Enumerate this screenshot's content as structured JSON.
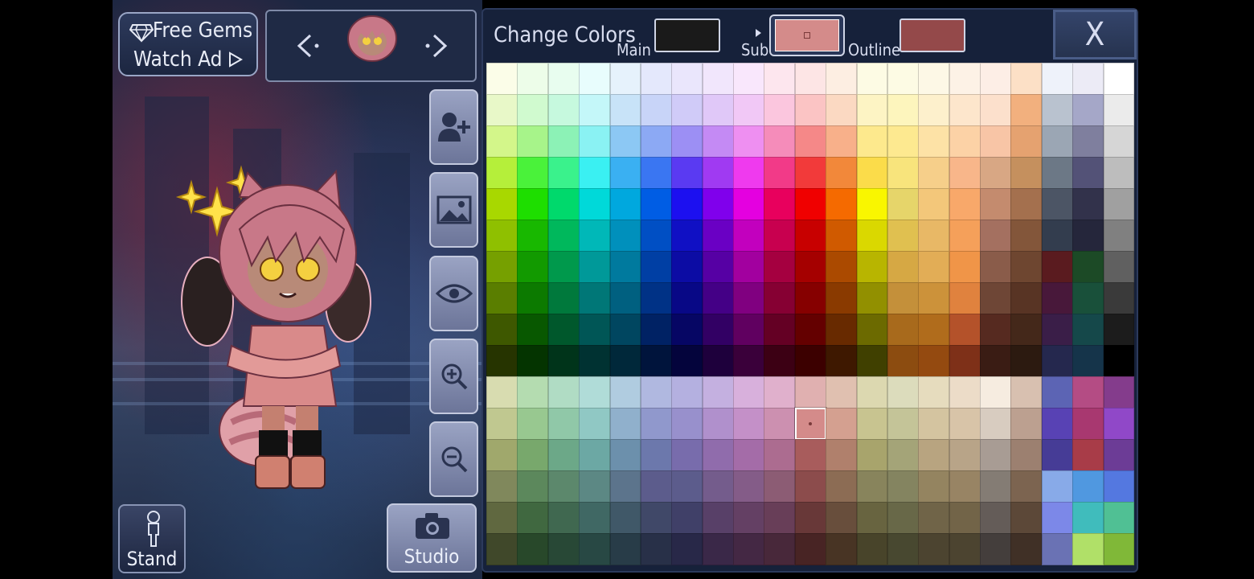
{
  "top": {
    "free_gems": "Free Gems",
    "watch_ad": "Watch Ad"
  },
  "bottom": {
    "stand_label": "Stand",
    "studio_label": "Studio"
  },
  "color_panel": {
    "title": "Change Colors",
    "main_label": "Main",
    "sub_label": "Sub",
    "outline_label": "Outline",
    "close_label": "X",
    "main_color": "#1a1a1a",
    "sub_color": "#d48b8a",
    "outline_color": "#94494a",
    "selected_cell": "#d48b8a"
  },
  "icons": [
    "diamond-icon",
    "play-triangle-icon",
    "arrow-left-icon",
    "arrow-right-icon",
    "add-character-icon",
    "background-image-icon",
    "eye-icon",
    "zoom-in-icon",
    "zoom-out-icon",
    "stand-pose-icon",
    "camera-icon",
    "close-icon"
  ],
  "palette": {
    "upper": [
      [
        "#fbfde8",
        "#edfde9",
        "#e8fdef",
        "#e8fdfd",
        "#e6f2fc",
        "#e4e8fc",
        "#eae6fc",
        "#f1e6fc",
        "#f9e7fc",
        "#fde6ee",
        "#fde5e5",
        "#fdeee2",
        "#fdfbe4",
        "#fdfbe4",
        "#fdf8e6",
        "#fdf2e6",
        "#fdeee6",
        "#fce0c6",
        "#eef2fa",
        "#ecebf6",
        "#ffffff"
      ],
      [
        "#e8f8c8",
        "#d0facf",
        "#c6f9de",
        "#c4f7f9",
        "#c8e3f8",
        "#c8d4f8",
        "#d0cbf8",
        "#e0c8f8",
        "#f1c8f6",
        "#fbc6de",
        "#fbc4c4",
        "#fbd9c2",
        "#fdf4c4",
        "#fdf5bd",
        "#fdf0cc",
        "#fde6cc",
        "#fce0cc",
        "#f2b07e",
        "#b9c2cf",
        "#a5a7c8",
        "#ebebeb"
      ],
      [
        "#d3f68a",
        "#a7f48a",
        "#8cf2b6",
        "#8af2f3",
        "#8cc8f4",
        "#8ca9f4",
        "#9c8ff4",
        "#c48af4",
        "#ee8ff1",
        "#f58cba",
        "#f58888",
        "#f8b08a",
        "#fde98d",
        "#fde990",
        "#fde2a6",
        "#fcd2a6",
        "#f8c5a6",
        "#e5a270",
        "#9ba6b4",
        "#7f7f9e",
        "#d6d6d6"
      ],
      [
        "#b5ef3a",
        "#4af23a",
        "#3af28c",
        "#3af0f2",
        "#3ab0f2",
        "#3a76f2",
        "#5a3af2",
        "#a03af2",
        "#ef3aee",
        "#f23a88",
        "#f23a3a",
        "#f2883a",
        "#fbdc4a",
        "#f8e47c",
        "#f6cf8a",
        "#f8b68a",
        "#d8a784",
        "#c5905e",
        "#6c7886",
        "#535277",
        "#bdbdbd"
      ],
      [
        "#a8d800",
        "#1ede00",
        "#00d96c",
        "#00d9d9",
        "#00a8de",
        "#005de4",
        "#1c10f0",
        "#8000ec",
        "#e400e0",
        "#e8005d",
        "#f00000",
        "#f56a00",
        "#f9f600",
        "#e6d56a",
        "#f3c77a",
        "#f8a86a",
        "#c48b6e",
        "#a4704e",
        "#4c5565",
        "#32324b",
        "#a0a0a0"
      ],
      [
        "#8fc000",
        "#18b800",
        "#00b85c",
        "#00b8b8",
        "#0090bc",
        "#004fc4",
        "#1010c4",
        "#6a00c4",
        "#c200be",
        "#c8004f",
        "#c80000",
        "#d05a00",
        "#dad800",
        "#e0c050",
        "#e8b866",
        "#f5a05a",
        "#a47060",
        "#83563a",
        "#333d4e",
        "#25263b",
        "#808080"
      ],
      [
        "#76a000",
        "#129a00",
        "#00994c",
        "#009999",
        "#007a9e",
        "#003fa4",
        "#0c0ca4",
        "#5600a4",
        "#a2009f",
        "#a50040",
        "#a50000",
        "#ab4a00",
        "#b8b500",
        "#d6a844",
        "#e2ad56",
        "#f09548",
        "#8a5c4a",
        "#6e4630",
        "#5a1b1f",
        "#1c4a26",
        "#606060"
      ],
      [
        "#5a7e00",
        "#0c7a00",
        "#00793c",
        "#007777",
        "#006080",
        "#003286",
        "#080886",
        "#440086",
        "#800080",
        "#860033",
        "#860000",
        "#8a3a00",
        "#929000",
        "#c4903a",
        "#cc923a",
        "#e0823e",
        "#6e4636",
        "#583424",
        "#48183a",
        "#19503a",
        "#3a3a3a"
      ],
      [
        "#3e5800",
        "#085800",
        "#00582c",
        "#005656",
        "#004660",
        "#002264",
        "#060664",
        "#320064",
        "#600060",
        "#640024",
        "#640000",
        "#682a00",
        "#6c6a00",
        "#a86a1c",
        "#b06c1c",
        "#b4522a",
        "#562a20",
        "#44281a",
        "#3a1e48",
        "#15484a",
        "#1c1c1c"
      ],
      [
        "#263400",
        "#043400",
        "#00341a",
        "#003232",
        "#00283a",
        "#00143c",
        "#04043c",
        "#1e003c",
        "#3a003a",
        "#3c0014",
        "#3c0000",
        "#3e1800",
        "#404000",
        "#8c4c10",
        "#944a10",
        "#7e3018",
        "#3a1c14",
        "#2c1a10",
        "#25284e",
        "#15344a",
        "#000000"
      ]
    ],
    "lower": [
      [
        "#d8dcb0",
        "#b4dcb0",
        "#b0dcc4",
        "#b0dcd8",
        "#b0cce0",
        "#b0b8e0",
        "#b4b0e0",
        "#c4b0e0",
        "#d8b0dc",
        "#e0b0cc",
        "#e0b0b0",
        "#e0c0b0",
        "#dcd8b0",
        "#dcdcbc",
        "#e6dcbe",
        "#ecdcc8",
        "#f6ece0",
        "#d8c0b0",
        "#5c64b4",
        "#b44c84",
        "#843c8c"
      ],
      [
        "#c0c890",
        "#98c890",
        "#90c8a8",
        "#90c8c4",
        "#90b0cc",
        "#9098cc",
        "#9890cc",
        "#b090cc",
        "#c490c8",
        "#cc90b0",
        "#d48b8a",
        "#d4a090",
        "#c8c490",
        "#c4c498",
        "#d4c4a0",
        "#d8c4a8",
        "#d8ccc0",
        "#bca090",
        "#5842b4",
        "#a83870",
        "#9048c8"
      ],
      [
        "#a0a86c",
        "#78a86c",
        "#6ca888",
        "#6ca8a4",
        "#6c90ac",
        "#6c78ac",
        "#786cac",
        "#906cac",
        "#a46ca8",
        "#ac6c90",
        "#a85c5c",
        "#b0806c",
        "#a8a46c",
        "#a4a478",
        "#b8a480",
        "#b8a488",
        "#a89c94",
        "#9c8070",
        "#463c96",
        "#a83c48",
        "#6c3c96"
      ],
      [
        "#80885c",
        "#5c885c",
        "#5c886c",
        "#5c8884",
        "#5c748c",
        "#5c5c8c",
        "#5c5c8c",
        "#745c8c",
        "#845c88",
        "#8c5c74",
        "#8c4c4c",
        "#8c6c54",
        "#88845c",
        "#848460",
        "#948460",
        "#988464",
        "#847c74",
        "#7c6450",
        "#88aae8",
        "#5098e0",
        "#5478e0"
      ],
      [
        "#606840",
        "#406840",
        "#406850",
        "#406864",
        "#405868",
        "#404868",
        "#404068",
        "#584068",
        "#644064",
        "#683e58",
        "#683838",
        "#684e3c",
        "#686440",
        "#686848",
        "#706448",
        "#726448",
        "#645c58",
        "#5c4838",
        "#7c88e8",
        "#40bcbc",
        "#50c094"
      ],
      [
        "#40482a",
        "#28482a",
        "#284836",
        "#284844",
        "#283c48",
        "#283048",
        "#282848",
        "#3a2848",
        "#442844",
        "#48283a",
        "#482424",
        "#483424",
        "#48442a",
        "#484830",
        "#4c4430",
        "#4c4430",
        "#443e3c",
        "#403026",
        "#6a72b4",
        "#b0e068",
        "#80b838"
      ]
    ]
  }
}
